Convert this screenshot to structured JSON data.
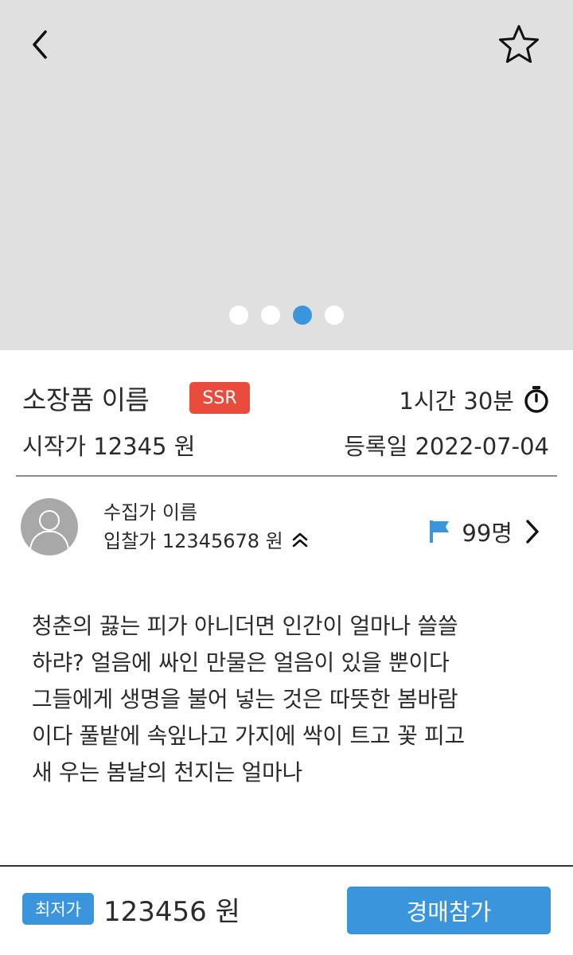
{
  "header": {
    "back_icon": "chevron-left-icon",
    "favorite_icon": "star-outline-icon"
  },
  "carousel": {
    "count": 4,
    "active_index": 2,
    "active_color": "#3a95dc"
  },
  "item": {
    "name": "소장품 이름",
    "grade": "SSR",
    "grade_color": "#e94c3d",
    "time_left": "1시간 30분",
    "start_price": "시작가 12345 원",
    "reg_date": "등록일 2022-07-04"
  },
  "collector": {
    "name": "수집가 이름",
    "bid_price": "입찰가 12345678 원",
    "bidder_count": "99명",
    "flag_color": "#3a95dc"
  },
  "description": "청춘의 끓는 피가 아니더면 인간이 얼마나 쓸쓸\n하랴? 얼음에 싸인 만물은 얼음이 있을 뿐이다\n그들에게 생명을 불어 넣는 것은 따뜻한 봄바람\n이다 풀밭에 속잎나고 가지에 싹이 트고 꽃 피고\n새 우는 봄날의 천지는 얼마나",
  "footer": {
    "lowest_label": "최저가",
    "lowest_price": "123456 원",
    "join_label": "경매참가",
    "accent": "#3a95dc"
  }
}
